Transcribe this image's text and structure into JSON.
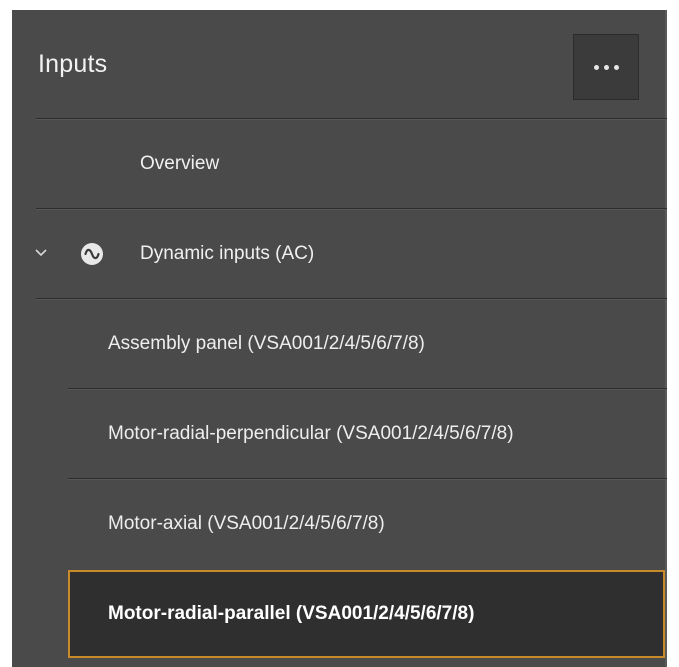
{
  "panel": {
    "title": "Inputs",
    "more_button": "more-horizontal"
  },
  "nav": {
    "overview_label": "Overview",
    "group": {
      "label": "Dynamic inputs (AC)",
      "expanded": true,
      "icon": "ac-sine-icon"
    },
    "items": [
      {
        "label": "Assembly panel (VSA001/2/4/5/6/7/8)",
        "selected": false
      },
      {
        "label": "Motor-radial-perpendicular (VSA001/2/4/5/6/7/8)",
        "selected": false
      },
      {
        "label": "Motor-axial (VSA001/2/4/5/6/7/8)",
        "selected": false
      },
      {
        "label": "Motor-radial-parallel (VSA001/2/4/5/6/7/8)",
        "selected": true
      }
    ]
  },
  "colors": {
    "panel_bg": "#4a4a4a",
    "selected_bg": "#2f2f2f",
    "selected_border": "#c98a2a",
    "text": "#f0f0f0"
  }
}
